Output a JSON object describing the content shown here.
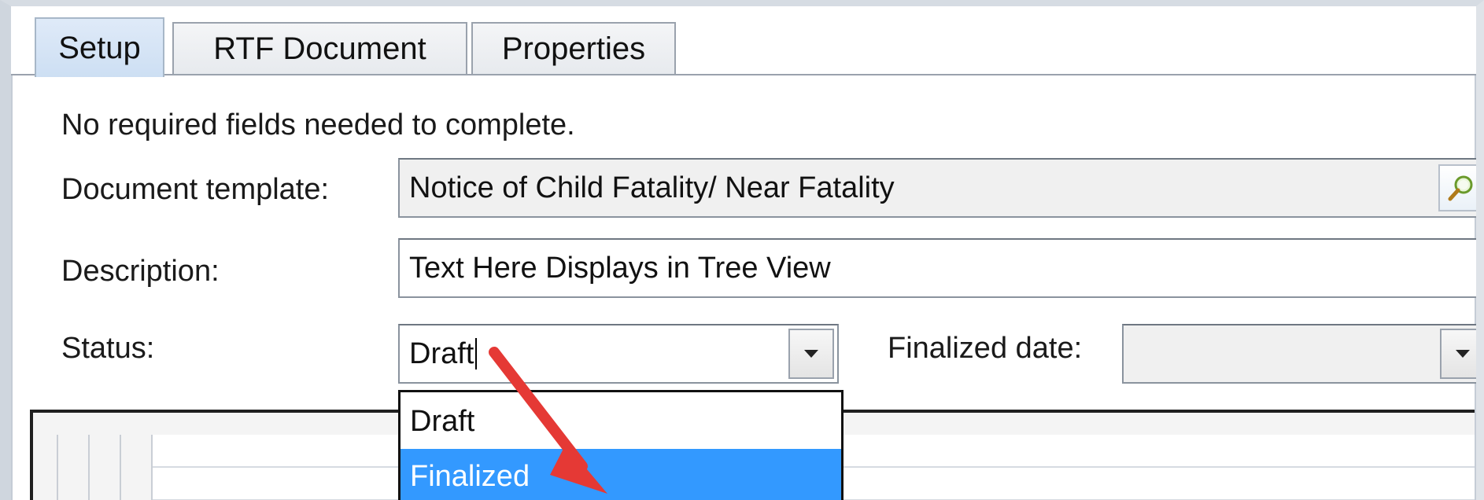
{
  "tabs": {
    "setup": "Setup",
    "rtf": "RTF Document",
    "properties": "Properties"
  },
  "setup": {
    "note": "No required fields needed to complete.",
    "template_label": "Document template:",
    "template_value": "Notice of Child Fatality/ Near Fatality",
    "description_label": "Description:",
    "description_value": "Text Here Displays in Tree View",
    "status_label": "Status:",
    "status_value": "Draft",
    "finalized_label": "Finalized date:",
    "finalized_value": ""
  },
  "status_dropdown": {
    "options": [
      "Draft",
      "Finalized"
    ],
    "highlighted": "Finalized"
  },
  "icons": {
    "lookup": "magnifier-icon",
    "dropdown": "chevron-down-icon"
  },
  "colors": {
    "selection": "#3399ff",
    "annotation_arrow": "#e53935",
    "active_tab": "#cddff3"
  }
}
